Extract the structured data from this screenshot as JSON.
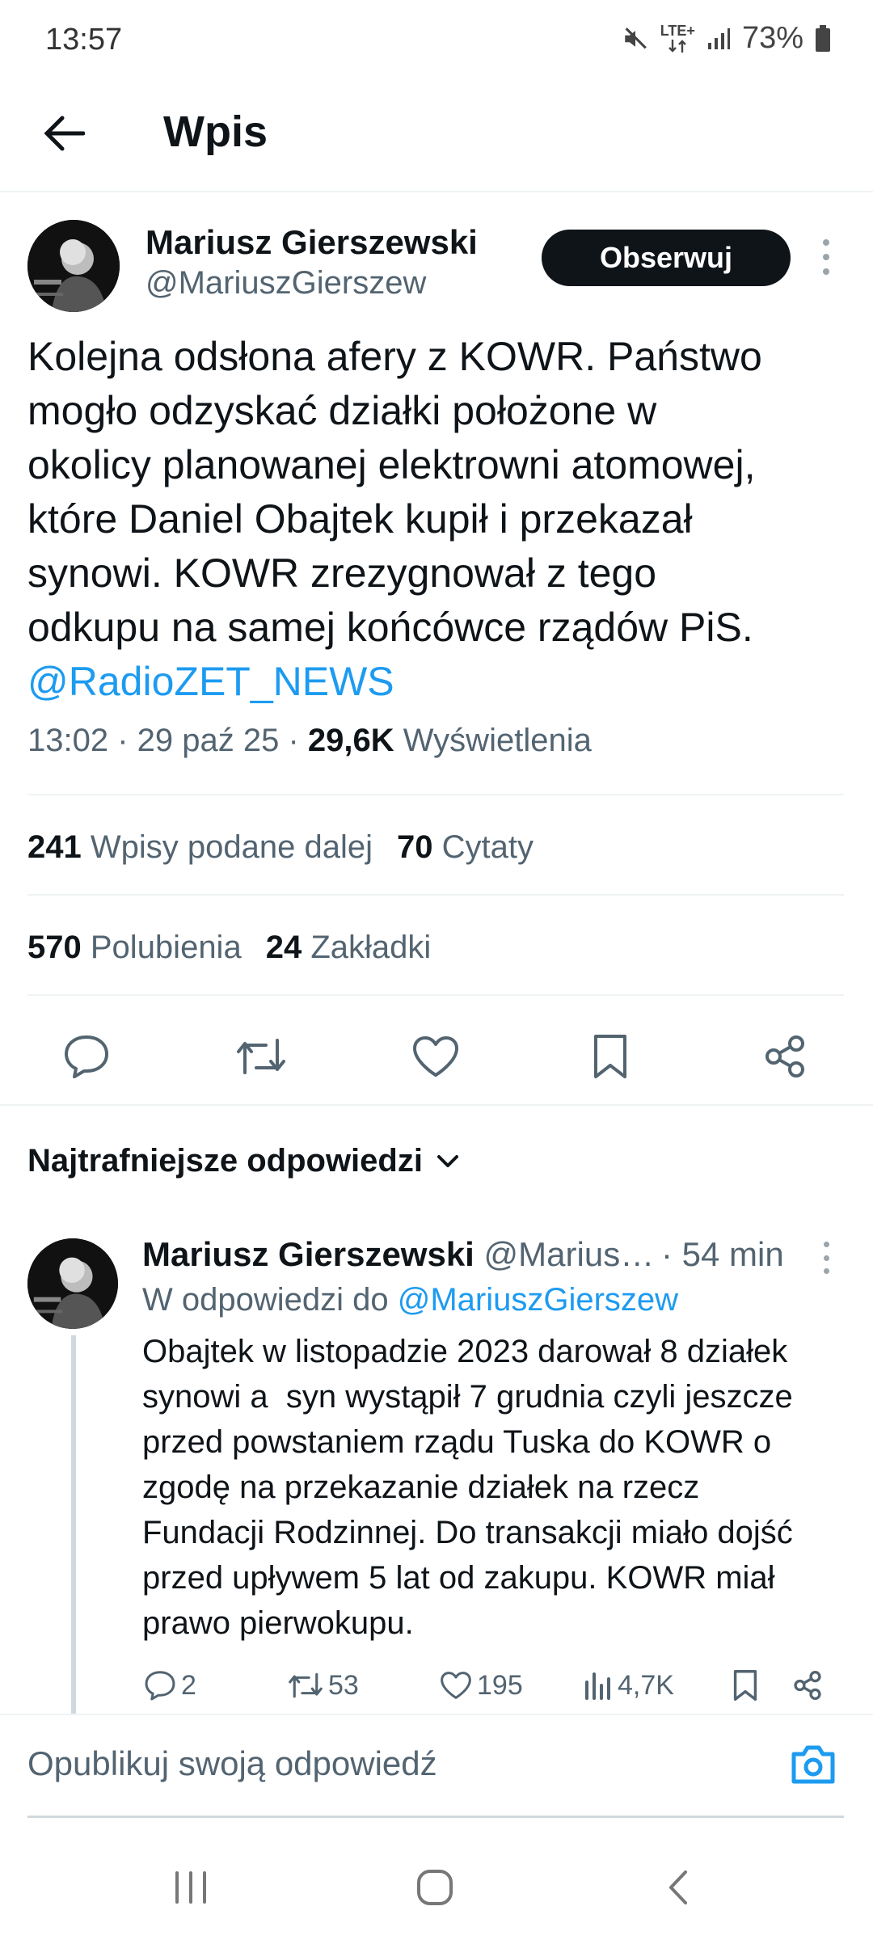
{
  "status_bar": {
    "time": "13:57",
    "network": "LTE+",
    "battery": "73%"
  },
  "header": {
    "title": "Wpis"
  },
  "tweet": {
    "author_name": "Mariusz Gierszewski",
    "author_handle": "@MariuszGierszew",
    "follow_label": "Obserwuj",
    "text_lines": [
      "Kolejna odsłona afery z KOWR. Państwo",
      "mogło odzyskać działki położone w",
      "okolicy planowanej elektrowni atomowej,",
      "które Daniel Obajtek kupił i przekazał",
      "synowi. KOWR zrezygnował z tego",
      "odkupu na samej końcówce rządów PiS."
    ],
    "mention": "@RadioZET_NEWS",
    "timestamp": "13:02 · 29 paź 25 · ",
    "views_count": "29,6K",
    "views_label": "Wyświetlenia",
    "reposts_count": "241",
    "reposts_label": "Wpisy podane dalej",
    "quotes_count": "70",
    "quotes_label": "Cytaty",
    "likes_count": "570",
    "likes_label": "Polubienia",
    "bookmarks_count": "24",
    "bookmarks_label": "Zakładki"
  },
  "replies_sort": {
    "label": "Najtrafniejsze odpowiedzi"
  },
  "reply": {
    "author_name": "Mariusz Gierszewski",
    "author_handle": "@Marius…",
    "time": "· 54 min",
    "reply_to_prefix": "W odpowiedzi do",
    "reply_to_handle": "@MariuszGierszew",
    "text_lines": [
      "Obajtek w listopadzie 2023 darował 8 działek",
      "synowi a  syn wystąpił 7 grudnia czyli jeszcze",
      "przed powstaniem rządu Tuska do KOWR o",
      "zgodę na przekazanie działek na rzecz",
      "Fundacji Rodzinnej. Do transakcji miało dojść",
      "przed upływem 5 lat od zakupu. KOWR miał",
      "prawo pierwokupu."
    ],
    "replies": "2",
    "reposts": "53",
    "likes": "195",
    "views": "4,7K"
  },
  "compose": {
    "placeholder": "Opublikuj swoją odpowiedź"
  },
  "colors": {
    "accent": "#1d9bf0",
    "text": "#0f1419",
    "secondary": "#536471",
    "divider": "#eff3f4"
  },
  "icons": {
    "back": "arrow-left-icon",
    "more": "more-vertical-icon",
    "reply": "comment-icon",
    "repost": "repost-icon",
    "like": "heart-icon",
    "bookmark": "bookmark-icon",
    "share": "share-icon",
    "views": "bar-chart-icon",
    "camera": "camera-icon",
    "chevron": "chevron-down-icon"
  }
}
